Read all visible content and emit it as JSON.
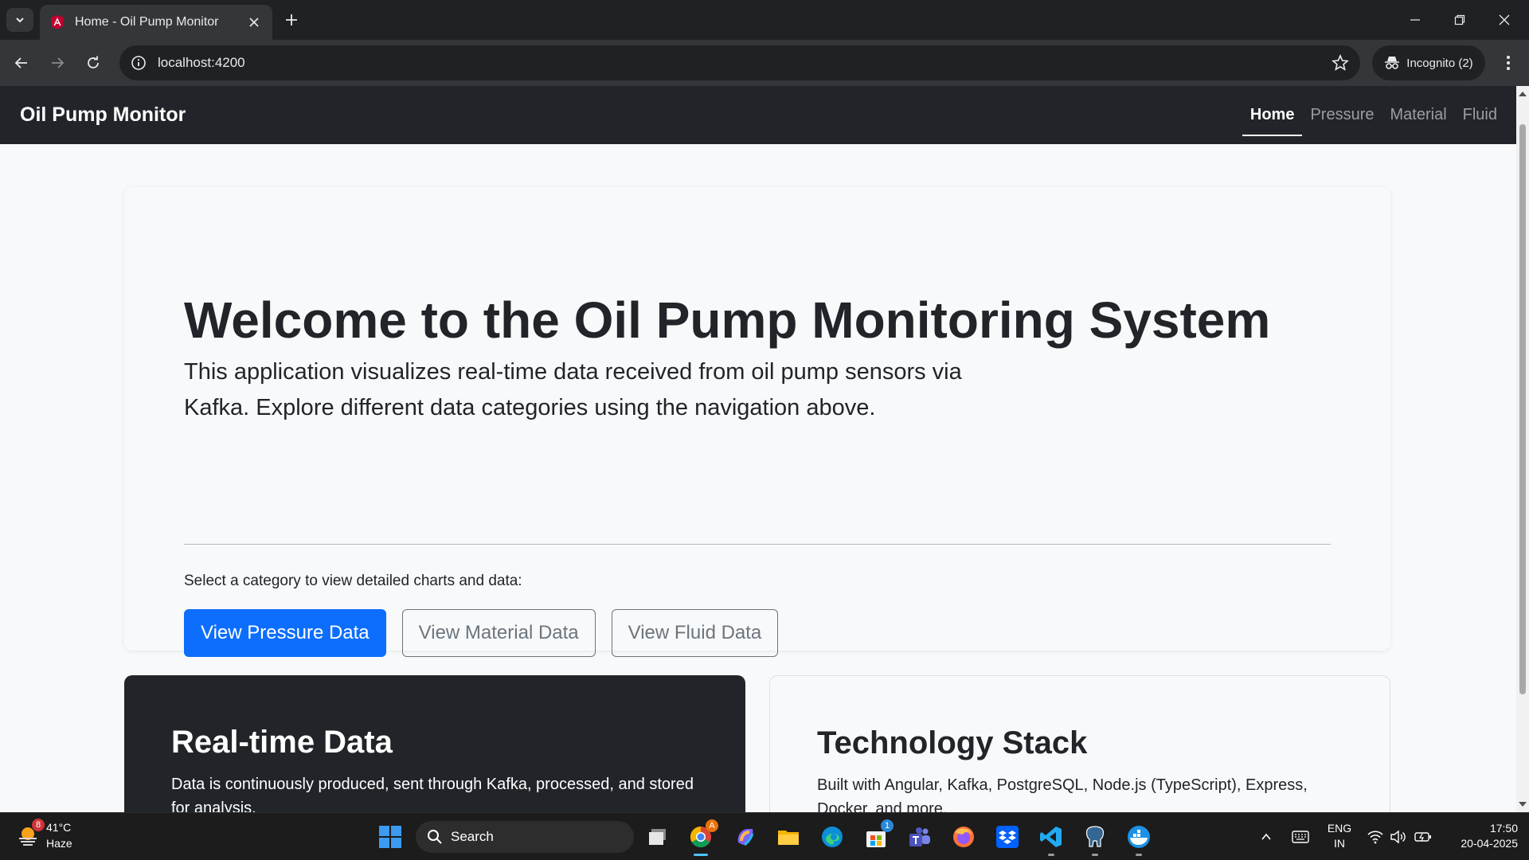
{
  "browser": {
    "tab_title": "Home - Oil Pump Monitor",
    "url": "localhost:4200",
    "incognito_label": "Incognito (2)"
  },
  "navbar": {
    "brand": "Oil Pump Monitor",
    "links": [
      "Home",
      "Pressure",
      "Material",
      "Fluid"
    ],
    "active": "Home"
  },
  "hero": {
    "title": "Welcome to the Oil Pump Monitoring System",
    "lead": "This application visualizes real-time data received from oil pump sensors via Kafka. Explore different data categories using the navigation above.",
    "prompt": "Select a category to view detailed charts and data:",
    "buttons": [
      "View Pressure Data",
      "View Material Data",
      "View Fluid Data"
    ]
  },
  "cards": [
    {
      "title": "Real-time Data",
      "text": "Data is continuously produced, sent through Kafka, processed, and stored for analysis."
    },
    {
      "title": "Technology Stack",
      "text": "Built with Angular, Kafka, PostgreSQL, Node.js (TypeScript), Express, Docker, and more."
    }
  ],
  "taskbar": {
    "weather_temp": "41°C",
    "weather_desc": "Haze",
    "weather_badge": "8",
    "search_label": "Search",
    "chrome_badge": "A",
    "store_badge": "1",
    "language_line1": "ENG",
    "language_line2": "IN",
    "time": "17:50",
    "date": "20-04-2025"
  },
  "colors": {
    "primary": "#0d6efd",
    "navbar_bg": "#212529",
    "page_bg": "#f8f9fa",
    "secondary": "#6c757d"
  }
}
